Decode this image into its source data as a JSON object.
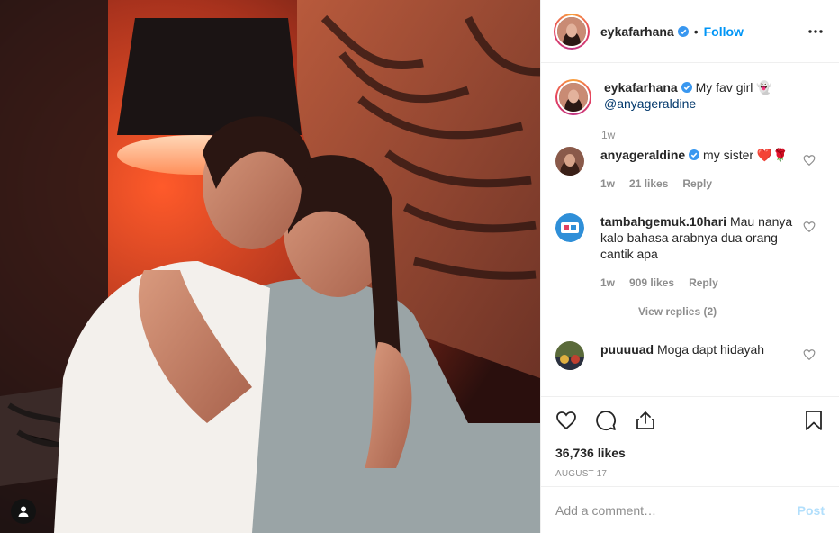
{
  "post": {
    "author": "eykafarhana",
    "follow_label": "Follow",
    "dot": "•",
    "more_icon": "more-horizontal-icon"
  },
  "caption": {
    "username": "eykafarhana",
    "text": "My fav girl 👻",
    "mention": "@anyageraldine",
    "time": "1w"
  },
  "comments": [
    {
      "username": "anyageraldine",
      "verified": true,
      "text": "my sister ❤️🌹",
      "time": "1w",
      "likes": "21 likes",
      "reply": "Reply"
    },
    {
      "username": "tambahgemuk.10hari",
      "verified": false,
      "text": "Mau nanya kalo bahasa arabnya dua orang cantik apa",
      "time": "1w",
      "likes": "909 likes",
      "reply": "Reply",
      "view_replies": "View replies (2)"
    },
    {
      "username": "puuuuad",
      "verified": false,
      "text": "Moga dapt hidayah"
    }
  ],
  "stats": {
    "likes": "36,736 likes",
    "date": "AUGUST 17"
  },
  "add_comment": {
    "placeholder": "Add a comment…",
    "post_label": "Post"
  },
  "colors": {
    "accent": "#0095f6",
    "verified": "#3897f0",
    "muted": "#8e8e8e",
    "post_disabled": "#b2dffc",
    "heart_red": "#ed4956"
  }
}
